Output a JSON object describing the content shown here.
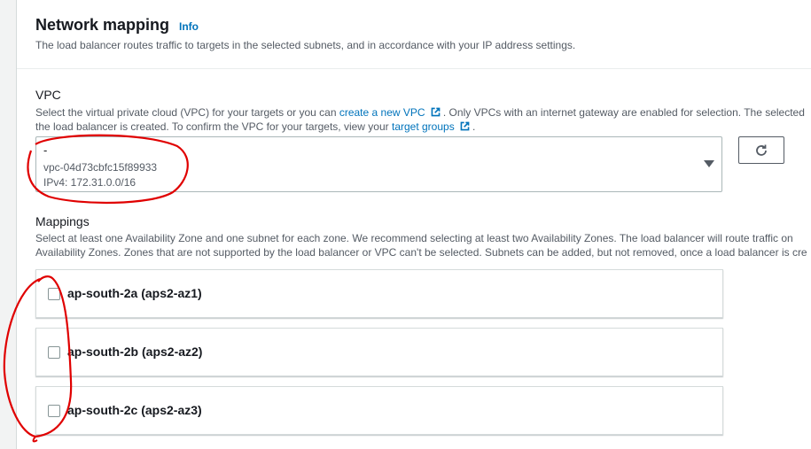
{
  "header": {
    "title": "Network mapping",
    "info": "Info",
    "description": "The load balancer routes traffic to targets in the selected subnets, and in accordance with your IP address settings."
  },
  "vpc": {
    "label": "VPC",
    "desc_line1_pre": "Select the virtual private cloud (VPC) for your targets or you can ",
    "create_link": "create a new VPC",
    "desc_line1_post": ". Only VPCs with an internet gateway are enabled for selection. The selected",
    "desc_line2_pre": "the load balancer is created. To confirm the VPC for your targets, view your ",
    "target_link": "target groups",
    "desc_line2_post": ".",
    "selected": {
      "name": "-",
      "id": "vpc-04d73cbfc15f89933",
      "cidr": "IPv4: 172.31.0.0/16"
    }
  },
  "mappings": {
    "label": "Mappings",
    "desc_line1": "Select at least one Availability Zone and one subnet for each zone. We recommend selecting at least two Availability Zones. The load balancer will route traffic on",
    "desc_line2": "Availability Zones. Zones that are not supported by the load balancer or VPC can't be selected. Subnets can be added, but not removed, once a load balancer is cre",
    "zones": [
      {
        "label": "ap-south-2a (aps2-az1)",
        "checked": false
      },
      {
        "label": "ap-south-2b (aps2-az2)",
        "checked": false
      },
      {
        "label": "ap-south-2c (aps2-az3)",
        "checked": false
      }
    ]
  },
  "icons": {
    "external": "external-link-icon",
    "refresh": "refresh-icon",
    "dropdown": "caret-down-icon"
  },
  "colors": {
    "link": "#0073bb",
    "annotation": "#e00000",
    "text": "#16191f",
    "muted": "#545b64"
  }
}
